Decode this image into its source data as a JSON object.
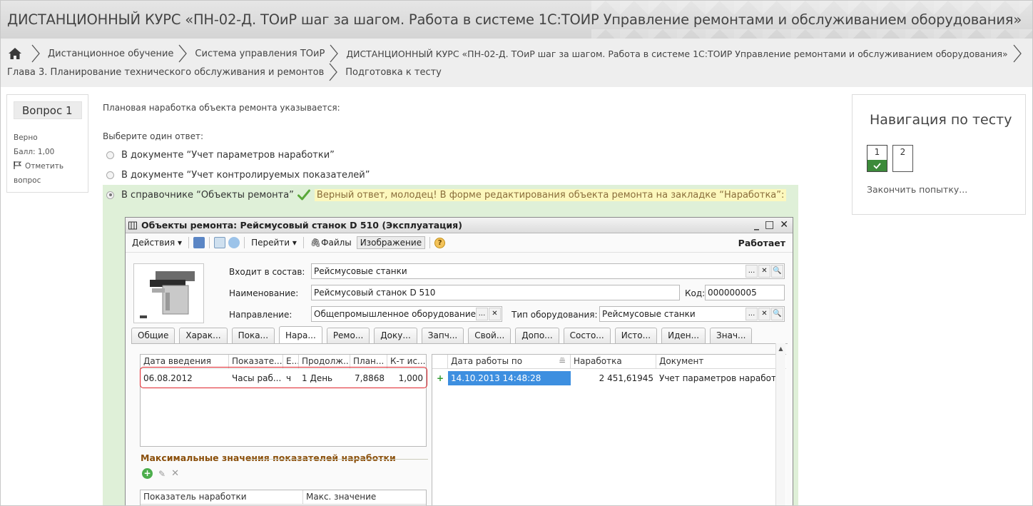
{
  "header": {
    "title": "ДИСТАНЦИОННЫЙ КУРС «ПН-02-Д. ТОиР шаг за шагом. Работа в системе 1С:ТОИР Управление ремонтами и обслуживанием оборудования»"
  },
  "breadcrumb": {
    "items": [
      "Дистанционное обучение",
      "Система управления ТОиР",
      "ДИСТАНЦИОННЫЙ КУРС «ПН-02-Д. ТОиР шаг за шагом. Работа в системе 1С:ТОИР Управление ремонтами и обслуживанием оборудования»",
      "Глава 3. Планирование технического обслуживания и ремонтов",
      "Подготовка к тесту"
    ]
  },
  "question_info": {
    "title": "Вопрос 1",
    "state": "Верно",
    "grade": "Балл: 1,00",
    "flag_label_1": "Отметить",
    "flag_label_2": "вопрос"
  },
  "question": {
    "text": "Плановая наработка объекта ремонта указывается:",
    "prompt": "Выберите один ответ:",
    "answers": [
      {
        "label": "В документе “Учет параметров наработки”",
        "selected": false
      },
      {
        "label": "В документе “Учет контролируемых показателей”",
        "selected": false
      },
      {
        "label": "В справочнике “Объекты ремонта”",
        "selected": true
      }
    ],
    "feedback": "Верный ответ, молодец! В форме редактирования объекта ремонта на закладке “Наработка”:"
  },
  "onec_window": {
    "title": "Объекты ремонта: Рейсмусовый станок D 510 (Эксплуатация)",
    "controls": [
      "_",
      "□",
      "✕"
    ],
    "toolbar": {
      "actions": "Действия",
      "goto": "Перейти",
      "files": "Файлы",
      "image": "Изображение",
      "help": "?",
      "status": "Работает"
    },
    "fields": {
      "parent_label": "Входит в состав:",
      "parent_value": "Рейсмусовые станки",
      "name_label": "Наименование:",
      "name_value": "Рейсмусовый станок D 510",
      "code_label": "Код:",
      "code_value": "000000005",
      "direction_label": "Направление:",
      "direction_value": "Общепромышленное оборудование",
      "eq_type_label": "Тип оборудования:",
      "eq_type_value": "Рейсмусовые станки"
    },
    "field_button_labels": {
      "select": "...",
      "clear": "✕",
      "search": "🔍"
    },
    "tabs": [
      "Общие",
      "Харак...",
      "Пока...",
      "Нара...",
      "Ремо...",
      "Доку...",
      "Запч...",
      "Свой...",
      "Допо...",
      "Состо...",
      "Исто...",
      "Иден...",
      "Знач..."
    ],
    "active_tab_index": 3,
    "left_grid": {
      "columns": [
        "Дата введения",
        "Показате...",
        "Е...",
        "Продолж...",
        "План...",
        "К-т ис..."
      ],
      "rows": [
        [
          "06.08.2012",
          "Часы раб...",
          "ч",
          "1  День",
          "7,8868",
          "1,000"
        ]
      ]
    },
    "right_grid": {
      "columns": [
        "Дата работы по",
        "Наработка",
        "Документ"
      ],
      "rows": [
        [
          "14.10.2013 14:48:28",
          "2 451,61945",
          "Учет параметров наработ"
        ]
      ],
      "row_marker": "+"
    },
    "max_values": {
      "title": "Максимальные значения показателей наработки",
      "columns": [
        "Показатель наработки",
        "Макс. значение"
      ]
    }
  },
  "nav": {
    "title": "Навигация по тесту",
    "buttons": [
      {
        "label": "1",
        "answered_correct": true
      },
      {
        "label": "2",
        "answered_correct": false
      }
    ],
    "finish": "Закончить попытку..."
  },
  "colors": {
    "correct_bg": "#dff0d8",
    "feedback_bg": "#fcf8bd",
    "highlight_red": "#e0232a",
    "nav_green": "#3c8a3a"
  }
}
